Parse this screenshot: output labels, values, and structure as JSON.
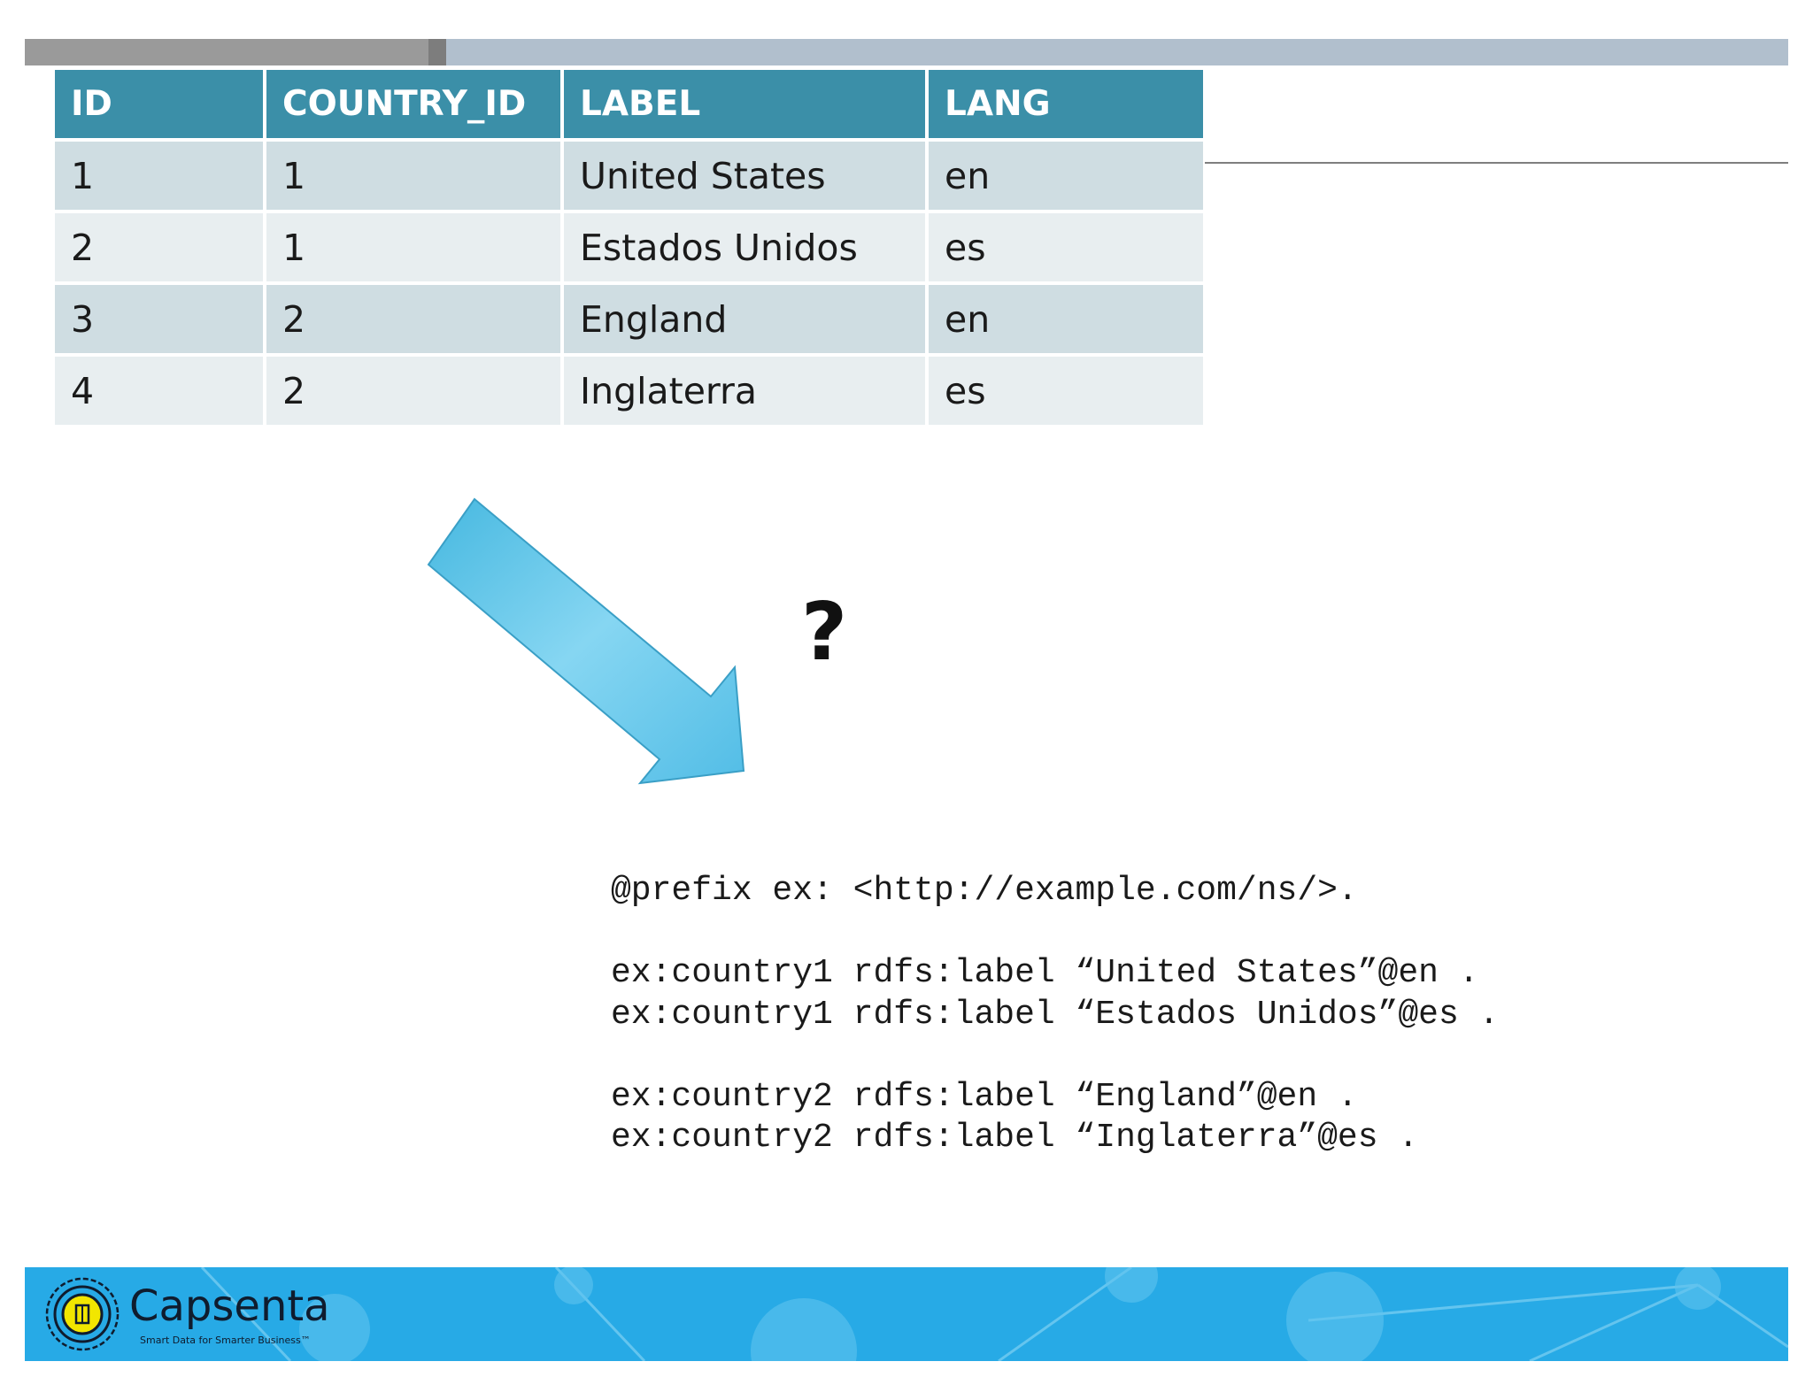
{
  "table": {
    "headers": [
      "ID",
      "COUNTRY_ID",
      "LABEL",
      "LANG"
    ],
    "rows": [
      [
        "1",
        "1",
        "United States",
        "en"
      ],
      [
        "2",
        "1",
        "Estados Unidos",
        "es"
      ],
      [
        "3",
        "2",
        "England",
        "en"
      ],
      [
        "4",
        "2",
        "Inglaterra",
        "es"
      ]
    ]
  },
  "question_mark": "?",
  "code": {
    "prefix_line": "@prefix ex: <http://example.com/ns/>.",
    "lines_group1": [
      "ex:country1 rdfs:label “United States”@en .",
      "ex:country1 rdfs:label “Estados Unidos”@es ."
    ],
    "lines_group2": [
      "ex:country2 rdfs:label “England”@en .",
      "ex:country2 rdfs:label “Inglaterra”@es ."
    ]
  },
  "footer": {
    "brand_name": "Capsenta",
    "tagline": "Smart Data for Smarter Business™"
  },
  "colors": {
    "table_header": "#3b8fa8",
    "row_odd": "#cfdde2",
    "row_even": "#e8eef0",
    "arrow": "#5cc8ec",
    "footer": "#27aae6"
  }
}
